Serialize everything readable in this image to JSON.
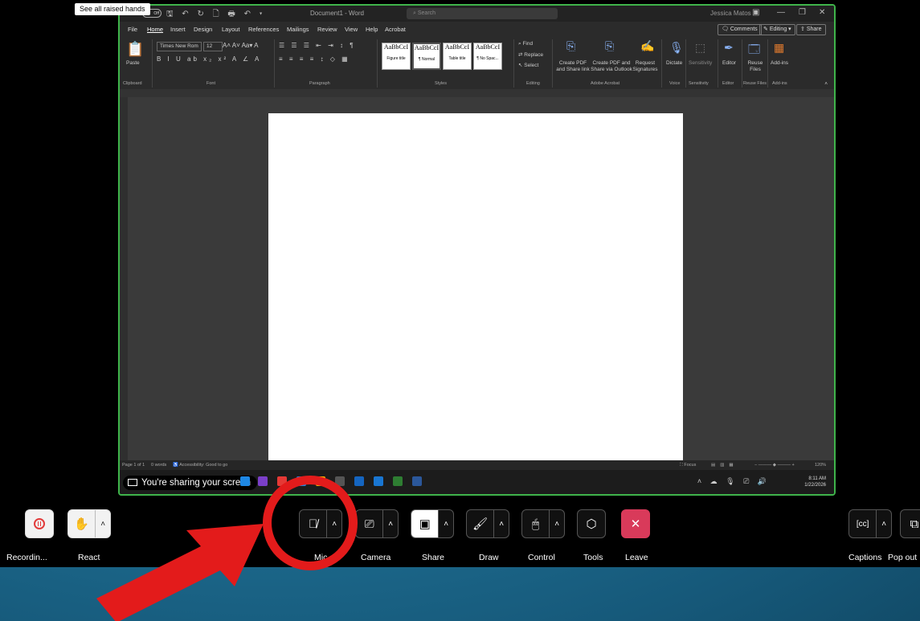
{
  "word": {
    "doc_title": "Document1 - Word",
    "search_placeholder": "Search",
    "user_name": "Jessica Matos",
    "autosave_label": "Off",
    "menu_tabs": [
      "File",
      "Home",
      "Insert",
      "Design",
      "Layout",
      "References",
      "Mailings",
      "Review",
      "View",
      "Help",
      "Acrobat"
    ],
    "comments_label": "Comments",
    "editing_label": "Editing",
    "share_label": "Share",
    "font_name": "Times New Rom",
    "font_size": "12",
    "paste_label": "Paste",
    "groups": {
      "clipboard": "Clipboard",
      "font": "Font",
      "paragraph": "Paragraph",
      "styles": "Styles",
      "editing": "Editing",
      "adobe": "Adobe Acrobat",
      "voice": "Voice",
      "sensitivity": "Sensitivity",
      "editor": "Editor",
      "reuse": "Reuse Files",
      "addins": "Add-ins"
    },
    "styles": [
      {
        "sample": "AaBbCcI",
        "name": "Figure title"
      },
      {
        "sample": "AaBbCcI",
        "name": "¶ Normal"
      },
      {
        "sample": "AaBbCcI",
        "name": "Table title"
      },
      {
        "sample": "AaBbCcI",
        "name": "¶ No Spac..."
      }
    ],
    "find_label": "Find",
    "replace_label": "Replace",
    "select_label": "Select",
    "acrobat": {
      "create_pdf": "Create PDF and Share link",
      "create_pdf_outlook": "Create PDF and Share via Outlook",
      "request_sig": "Request Signatures"
    },
    "dictate_label": "Dictate",
    "sensitivity_label": "Sensitivity",
    "editor_label": "Editor",
    "reuse_label": "Reuse Files",
    "addins_label": "Add-ins",
    "status": {
      "page": "Page 1 of 1",
      "words": "0 words",
      "accessibility": "Accessibility: Good to go",
      "focus": "Focus",
      "zoom": "120%"
    }
  },
  "raised_hands_label": "See all raised hands",
  "taskbar": {
    "sharing_label": "You're sharing your screen",
    "time": "8:11 AM",
    "date": "1/22/2026"
  },
  "controls": {
    "recording": "Recordin...",
    "react": "React",
    "mic": "Mic",
    "camera": "Camera",
    "share": "Share",
    "draw": "Draw",
    "control": "Control",
    "tools": "Tools",
    "leave": "Leave",
    "captions": "Captions",
    "popout": "Pop out"
  },
  "colors": {
    "annotation_red": "#e31b1b",
    "share_border_green": "#3fb44b",
    "leave_pink": "#d93a5a"
  }
}
